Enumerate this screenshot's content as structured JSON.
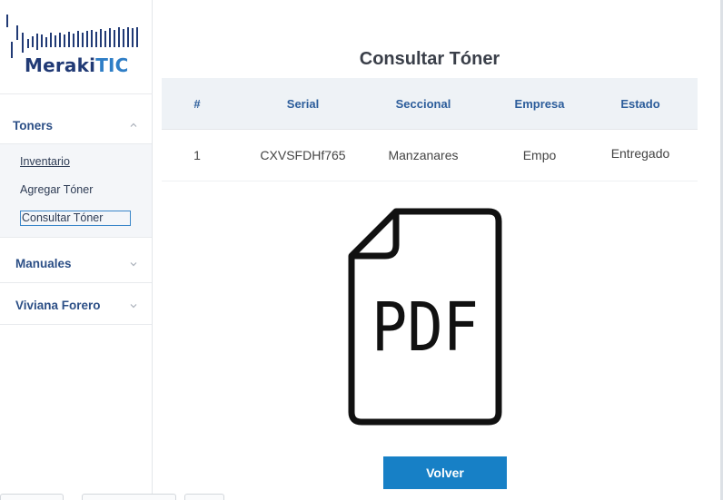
{
  "brand": {
    "name_part1": "Meraki",
    "name_part2": "TIC",
    "color_dark": "#213a75",
    "color_accent": "#2f7ec6"
  },
  "sidebar": {
    "sections": [
      {
        "label": "Toners",
        "expanded": true,
        "icon": "chevron-up-icon",
        "items": [
          {
            "label": "Inventario"
          },
          {
            "label": "Agregar Tóner"
          },
          {
            "label": "Consultar Tóner"
          }
        ]
      },
      {
        "label": "Manuales",
        "expanded": false,
        "icon": "chevron-down-icon"
      },
      {
        "label": "Viviana Forero",
        "expanded": false,
        "icon": "chevron-down-icon"
      }
    ]
  },
  "page": {
    "title": "Consultar Tóner"
  },
  "table": {
    "headers": [
      "#",
      "Serial",
      "Seccional",
      "Empresa",
      "Estado"
    ],
    "rows": [
      [
        "1",
        "CXVSFDHf765",
        "Manzanares",
        "Empo",
        "Entregado"
      ]
    ]
  },
  "document": {
    "icon": "pdf-file-icon",
    "label": "PDF"
  },
  "actions": {
    "back_label": "Volver",
    "button_color": "#1780c6"
  }
}
